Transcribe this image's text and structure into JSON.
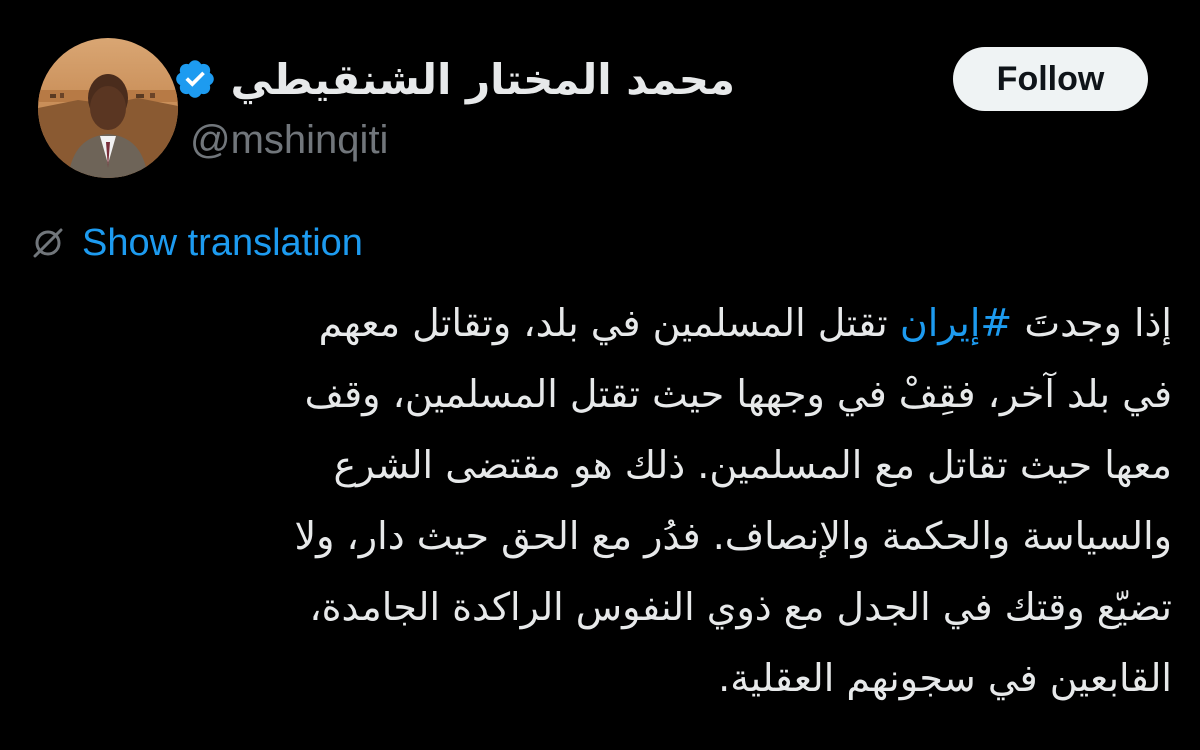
{
  "author": {
    "display_name": "محمد المختار الشنقيطي",
    "handle": "@mshinqiti",
    "verified": true,
    "verified_color": "#1d9bf0",
    "avatar_icon": "profile-photo"
  },
  "follow_button": {
    "label": "Follow"
  },
  "translation": {
    "label": "Show translation",
    "icon": "globe-slash-icon"
  },
  "tweet": {
    "lines": [
      {
        "before": "إذا وجدتَ ",
        "hashtag": "#إيران",
        "after": " تقتل المسلمين في بلد، وتقاتل معهم"
      },
      "في بلد آخر، فقِفْ في وجهها حيث تقتل المسلمين، وقف",
      "معها حيث تقاتل مع المسلمين. ذلك هو مقتضى الشرع",
      "والسياسة والحكمة والإنصاف. فدُر مع الحق حيث دار، ولا",
      "تضيّع وقتك في الجدل مع ذوي النفوس الراكدة الجامدة،",
      "القابعين في سجونهم العقلية."
    ]
  },
  "colors": {
    "background": "#000000",
    "text": "#e7e9ea",
    "muted": "#71767b",
    "link": "#1d9bf0",
    "button_bg": "#eff3f4"
  }
}
